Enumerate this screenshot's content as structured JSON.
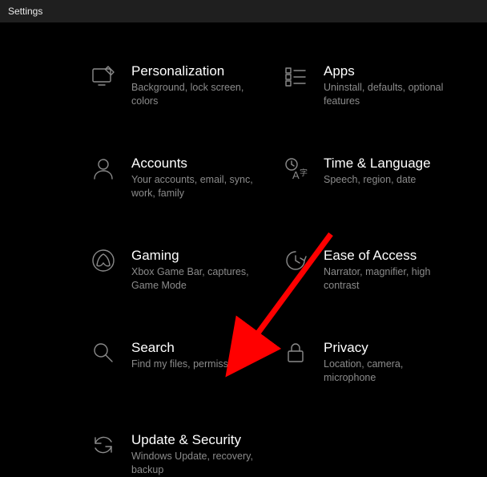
{
  "titlebar": {
    "label": "Settings"
  },
  "tiles": [
    {
      "title": "Personalization",
      "desc": "Background, lock screen, colors"
    },
    {
      "title": "Apps",
      "desc": "Uninstall, defaults, optional features"
    },
    {
      "title": "Accounts",
      "desc": "Your accounts, email, sync, work, family"
    },
    {
      "title": "Time & Language",
      "desc": "Speech, region, date"
    },
    {
      "title": "Gaming",
      "desc": "Xbox Game Bar, captures, Game Mode"
    },
    {
      "title": "Ease of Access",
      "desc": "Narrator, magnifier, high contrast"
    },
    {
      "title": "Search",
      "desc": "Find my files, permissions"
    },
    {
      "title": "Privacy",
      "desc": "Location, camera, microphone"
    },
    {
      "title": "Update & Security",
      "desc": "Windows Update, recovery, backup"
    }
  ],
  "annotation": {
    "arrow_color": "#ff0000"
  }
}
